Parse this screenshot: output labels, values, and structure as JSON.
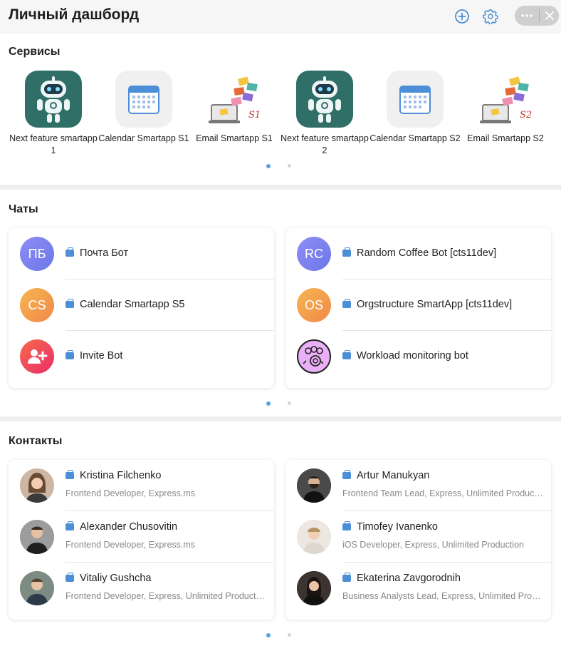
{
  "header": {
    "title": "Личный дашборд",
    "icons": [
      "add-circle-icon",
      "gear-icon",
      "more-icon",
      "close-icon"
    ]
  },
  "services": {
    "title": "Сервисы",
    "items": [
      {
        "label": "Next feature smartapp 1",
        "icon": "robot-icon"
      },
      {
        "label": "Calendar Smartapp S1",
        "icon": "calendar-icon"
      },
      {
        "label": "Email Smartapp S1",
        "icon": "email-icon",
        "badge": "S1"
      },
      {
        "label": "Next feature smartapp 2",
        "icon": "robot-icon"
      },
      {
        "label": "Calendar Smartapp S2",
        "icon": "calendar-icon"
      },
      {
        "label": "Email Smartapp S2",
        "icon": "email-icon",
        "badge": "S2"
      }
    ],
    "pager": {
      "pages": 2,
      "active": 1
    }
  },
  "chats": {
    "title": "Чаты",
    "left": [
      {
        "initials": "ПБ",
        "name": "Почта Бот",
        "color": "#7c7ff0"
      },
      {
        "initials": "CS",
        "name": "Calendar Smartapp S5",
        "color": "#f4a24a"
      },
      {
        "initials": "",
        "name": "Invite Bot",
        "color": "#f0435a",
        "icon": "add-user-icon"
      }
    ],
    "right": [
      {
        "initials": "RC",
        "name": "Random Coffee Bot [cts11dev]",
        "color": "#7c7ff0"
      },
      {
        "initials": "OS",
        "name": "Orgstructure SmartApp [cts11dev]",
        "color": "#f4a24a"
      },
      {
        "initials": "",
        "name": "Workload monitoring bot",
        "color": "#e9a6f5",
        "icon": "team-icon"
      }
    ],
    "pager": {
      "pages": 2,
      "active": 1
    }
  },
  "contacts": {
    "title": "Контакты",
    "left": [
      {
        "name": "Kristina Filchenko",
        "role": "Frontend Developer, Express.ms"
      },
      {
        "name": "Alexander Chusovitin",
        "role": "Frontend Developer, Express.ms"
      },
      {
        "name": "Vitaliy Gushcha",
        "role": "Frontend Developer, Express, Unlimited Production"
      }
    ],
    "right": [
      {
        "name": "Artur Manukyan",
        "role": "Frontend Team Lead, Express, Unlimited Production"
      },
      {
        "name": "Timofey Ivanenko",
        "role": "iOS Developer, Express, Unlimited Production"
      },
      {
        "name": "Ekaterina Zavgorodnih",
        "role": "Business Analysts Lead, Express, Unlimited Production"
      }
    ],
    "pager": {
      "pages": 2,
      "active": 1
    }
  },
  "colors": {
    "accent": "#4c8fd6",
    "robot_bg": "#2f6f68"
  }
}
